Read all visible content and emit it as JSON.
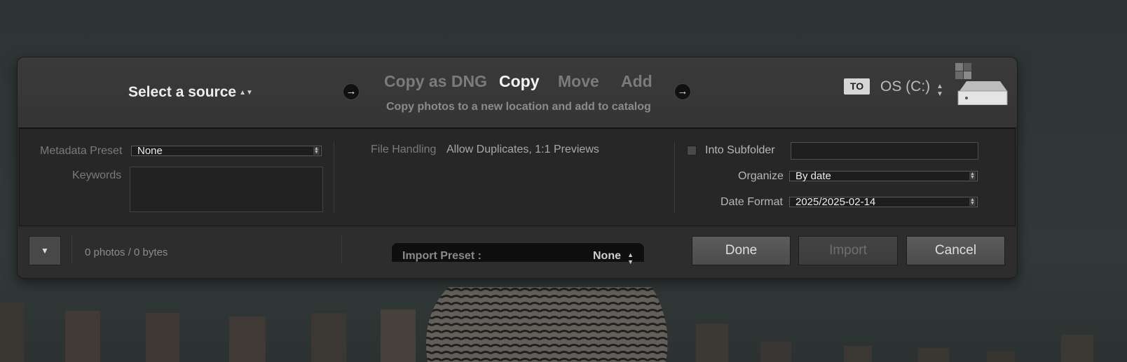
{
  "source": {
    "label": "Select a source"
  },
  "modes": {
    "items": [
      "Copy as DNG",
      "Copy",
      "Move",
      "Add"
    ],
    "active": "Copy",
    "description": "Copy photos to a new location and add to catalog"
  },
  "destination": {
    "badge": "TO",
    "drive": "OS (C:)"
  },
  "metadata": {
    "preset_label": "Metadata Preset",
    "preset_value": "None",
    "keywords_label": "Keywords"
  },
  "file_handling": {
    "label": "File Handling",
    "value": "Allow Duplicates, 1:1 Previews"
  },
  "dest_settings": {
    "subfolder_label": "Into Subfolder",
    "organize_label": "Organize",
    "organize_value": "By date",
    "date_format_label": "Date Format",
    "date_format_value": "2025/2025-02-14"
  },
  "bottom": {
    "count": "0 photos / 0 bytes",
    "import_preset_label": "Import Preset :",
    "import_preset_value": "None",
    "done": "Done",
    "import": "Import",
    "cancel": "Cancel"
  },
  "icons": {
    "arrow": "arrow-right-icon",
    "drive": "hard-drive-icon",
    "updown": "updown-chevron-icon",
    "expand": "triangle-down-icon"
  }
}
